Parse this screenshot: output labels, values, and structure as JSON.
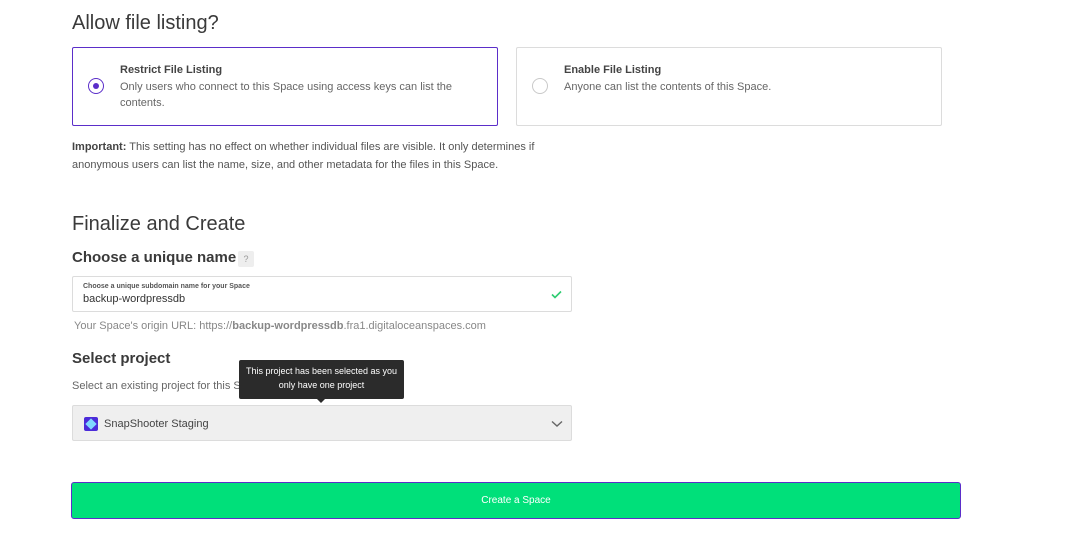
{
  "listing": {
    "title": "Allow file listing?",
    "options": [
      {
        "title": "Restrict File Listing",
        "description": "Only users who connect to this Space using access keys can list the contents.",
        "selected": true
      },
      {
        "title": "Enable File Listing",
        "description": "Anyone can list the contents of this Space.",
        "selected": false
      }
    ],
    "note_label": "Important:",
    "note_text": " This setting has no effect on whether individual files are visible. It only determines if anonymous users can list the name, size, and other metadata for the files in this Space."
  },
  "finalize": {
    "title": "Finalize and Create",
    "name_heading": "Choose a unique name",
    "help_icon": "question-icon",
    "help_glyph": "?",
    "field_label": "Choose a unique subdomain name for your Space",
    "field_value": "backup-wordpressdb",
    "valid_icon": "checkmark-icon",
    "origin_prefix": "Your Space's origin URL: https://",
    "origin_name": "backup-wordpressdb",
    "origin_suffix": ".fra1.digitaloceanspaces.com"
  },
  "project": {
    "heading": "Select project",
    "hint": "Select an existing project for this Space",
    "selected": "SnapShooter Staging",
    "dropdown_icon": "chevron-down-icon",
    "tooltip": "This project has been selected as you only have one project"
  },
  "create_button": "Create a Space",
  "colors": {
    "accent": "#5b2ec9",
    "button": "#00e07a",
    "valid": "#2ecc71",
    "tooltip_bg": "#2b2b2b"
  }
}
